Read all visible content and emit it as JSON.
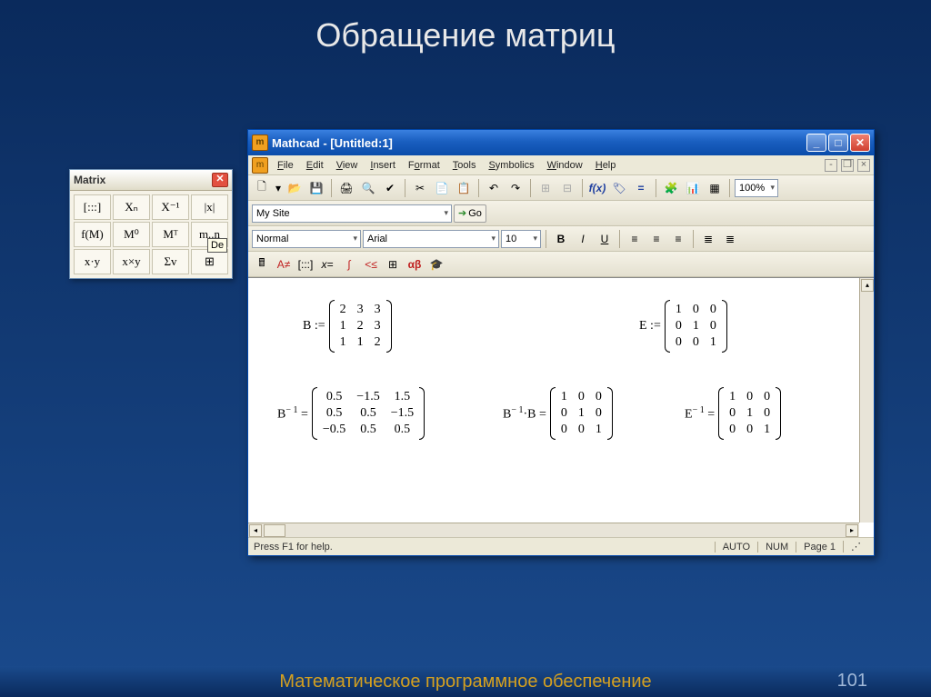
{
  "slide": {
    "title": "Обращение матриц",
    "footer": "Математическое программное обеспечение",
    "page": "101"
  },
  "palette": {
    "title": "Matrix",
    "tooltip": "De",
    "cells": [
      "[:::]",
      "Xₙ",
      "X⁻¹",
      "|x|",
      "f(M)",
      "M⁰",
      "Mᵀ",
      "m..n",
      "x·y",
      "x×y",
      "Σv",
      "⊞"
    ]
  },
  "mathcad": {
    "title": "Mathcad - [Untitled:1]",
    "menu": [
      "File",
      "Edit",
      "View",
      "Insert",
      "Format",
      "Tools",
      "Symbolics",
      "Window",
      "Help"
    ],
    "zoom": "100%",
    "site_combo": "My Site",
    "go": "Go",
    "style": "Normal",
    "font": "Arial",
    "size": "10",
    "status": "Press F1 for help.",
    "status_cells": [
      "AUTO",
      "NUM",
      "Page 1"
    ]
  },
  "equations": {
    "B_def": {
      "label": "B :=",
      "rows": [
        [
          "2",
          "3",
          "3"
        ],
        [
          "1",
          "2",
          "3"
        ],
        [
          "1",
          "1",
          "2"
        ]
      ]
    },
    "E_def": {
      "label": "E :=",
      "rows": [
        [
          "1",
          "0",
          "0"
        ],
        [
          "0",
          "1",
          "0"
        ],
        [
          "0",
          "0",
          "1"
        ]
      ]
    },
    "B_inv": {
      "label_pre": "B",
      "exp": "− 1",
      "label_post": " =",
      "rows": [
        [
          "0.5",
          "−1.5",
          "1.5"
        ],
        [
          "0.5",
          "0.5",
          "−1.5"
        ],
        [
          "−0.5",
          "0.5",
          "0.5"
        ]
      ]
    },
    "BinvB": {
      "label_pre": "B",
      "exp": "− 1",
      "label_post": "·B =",
      "rows": [
        [
          "1",
          "0",
          "0"
        ],
        [
          "0",
          "1",
          "0"
        ],
        [
          "0",
          "0",
          "1"
        ]
      ]
    },
    "E_inv": {
      "label_pre": "E",
      "exp": "− 1",
      "label_post": " =",
      "rows": [
        [
          "1",
          "0",
          "0"
        ],
        [
          "0",
          "1",
          "0"
        ],
        [
          "0",
          "0",
          "1"
        ]
      ]
    }
  }
}
